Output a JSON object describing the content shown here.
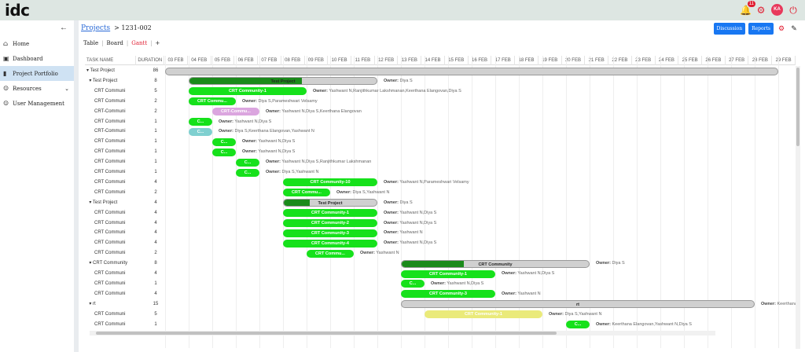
{
  "app": {
    "logo": "idc",
    "bell_count": "11",
    "avatar": "KA"
  },
  "sidebar": {
    "items": [
      {
        "label": "Home",
        "icon": "home-icon"
      },
      {
        "label": "Dashboard",
        "icon": "dashboard-icon"
      },
      {
        "label": "Project Portfolio",
        "icon": "portfolio-icon"
      },
      {
        "label": "Resources",
        "icon": "people-icon"
      },
      {
        "label": "User Management",
        "icon": "users-icon"
      }
    ]
  },
  "breadcrumb": {
    "link": "Projects",
    "current": "> 1231-002"
  },
  "views": {
    "table": "Table",
    "board": "Board",
    "gantt": "Gantt",
    "add": "+"
  },
  "actions": {
    "discussion": "Discussion",
    "reports": "Reports"
  },
  "columns": {
    "task": "TASK NAME",
    "duration": "DURATION"
  },
  "dates": [
    "03 FEB",
    "04 FEB",
    "05 FEB",
    "06 FEB",
    "07 FEB",
    "08 FEB",
    "09 FEB",
    "10 FEB",
    "11 FEB",
    "12 FEB",
    "13 FEB",
    "14 FEB",
    "15 FEB",
    "16 FEB",
    "17 FEB",
    "18 FEB",
    "19 FEB",
    "20 FEB",
    "21 FEB",
    "22 FEB",
    "23 FEB",
    "24 FEB",
    "25 FEB",
    "26 FEB",
    "27 FEB",
    "28 FEB",
    "29 FEB"
  ],
  "owner_label": "Owner:",
  "colors": {
    "green": "#16e11b",
    "dark_green": "#1a8a1a",
    "pink": "#dba5df",
    "teal": "#7fd0d0",
    "yellow": "#eaea7a",
    "grey": "#d0d0d0"
  },
  "tasks": [
    {
      "name": "▾ Test Project",
      "dur": "86",
      "start": 0,
      "len": 26,
      "type": "proj",
      "label": "",
      "owner": "",
      "progress": 0
    },
    {
      "name": "  ▾ Test Project",
      "dur": "8",
      "start": 1,
      "len": 8,
      "type": "proj",
      "label": "Test Project",
      "owner": "Diya S",
      "progress": 0.6
    },
    {
      "name": "      CRT Communi",
      "dur": "5",
      "start": 1,
      "len": 5,
      "type": "green",
      "label": "CRT Community-1",
      "owner": "Yashwant N,Ranjithkumar Lakshmanan,Keerthana Elangovan,Diya S",
      "progress": 0
    },
    {
      "name": "      CRT Communi",
      "dur": "2",
      "start": 1,
      "len": 2,
      "type": "green",
      "label": "CRT Commu...",
      "owner": "Diya S,Parameshwari Velsamy",
      "progress": 0
    },
    {
      "name": "      CRT-Communi",
      "dur": "2",
      "start": 2,
      "len": 2,
      "type": "pink",
      "label": "CRT-Commu...",
      "owner": "Yashwant N,Diya S,Keerthana Elangovan",
      "progress": 0
    },
    {
      "name": "      CRT Communi",
      "dur": "1",
      "start": 1,
      "len": 1,
      "type": "green",
      "label": "C...",
      "owner": "Yashwant N,Diya S",
      "progress": 0
    },
    {
      "name": "      CRT-Communi",
      "dur": "1",
      "start": 1,
      "len": 1,
      "type": "teal",
      "label": "C...",
      "owner": "Diya S,Keerthana Elangovan,Yashwant N",
      "progress": 0
    },
    {
      "name": "      CRT Communi",
      "dur": "1",
      "start": 2,
      "len": 1,
      "type": "green",
      "label": "C...",
      "owner": "Yashwant N,Diya S",
      "progress": 0
    },
    {
      "name": "      CRT Communi",
      "dur": "1",
      "start": 2,
      "len": 1,
      "type": "green",
      "label": "C...",
      "owner": "Yashwant N,Diya S",
      "progress": 0
    },
    {
      "name": "      CRT Communi",
      "dur": "1",
      "start": 3,
      "len": 1,
      "type": "green",
      "label": "C...",
      "owner": "Yashwant N,Diya S,Ranjithkumar Lakshmanan",
      "progress": 0
    },
    {
      "name": "      CRT Communi",
      "dur": "1",
      "start": 3,
      "len": 1,
      "type": "green",
      "label": "C...",
      "owner": "Diya S,Yashwant N",
      "progress": 0
    },
    {
      "name": "      CRT Communi",
      "dur": "4",
      "start": 5,
      "len": 4,
      "type": "green",
      "label": "CRT Community-10",
      "owner": "Yashwant N,Parameshwari Velsamy",
      "progress": 0
    },
    {
      "name": "      CRT Communi",
      "dur": "2",
      "start": 5,
      "len": 2,
      "type": "green",
      "label": "CRT Commu...",
      "owner": "Diya S,Yashwant N",
      "progress": 0
    },
    {
      "name": "  ▾ Test Project",
      "dur": "4",
      "start": 5,
      "len": 4,
      "type": "proj",
      "label": "Test Project",
      "owner": "Diya S",
      "progress": 0.28
    },
    {
      "name": "      CRT Communi",
      "dur": "4",
      "start": 5,
      "len": 4,
      "type": "green",
      "label": "CRT Community-1",
      "owner": "Yashwant N,Diya S",
      "progress": 0
    },
    {
      "name": "      CRT Communi",
      "dur": "4",
      "start": 5,
      "len": 4,
      "type": "green",
      "label": "CRT Community-2",
      "owner": "Yashwant N,Diya S",
      "progress": 0
    },
    {
      "name": "      CRT Communi",
      "dur": "4",
      "start": 5,
      "len": 4,
      "type": "green",
      "label": "CRT Community-3",
      "owner": "Yashwant N",
      "progress": 0
    },
    {
      "name": "      CRT Communi",
      "dur": "4",
      "start": 5,
      "len": 4,
      "type": "green",
      "label": "CRT Community-4",
      "owner": "Yashwant N,Diya S",
      "progress": 0
    },
    {
      "name": "      CRT Communi",
      "dur": "2",
      "start": 6,
      "len": 2,
      "type": "green",
      "label": "CRT Commu...",
      "owner": "Yashwant N",
      "progress": 0
    },
    {
      "name": "  ▾ CRT Community",
      "dur": "8",
      "start": 10,
      "len": 8,
      "type": "proj",
      "label": "CRT Community",
      "owner": "Diya S",
      "progress": 0.33
    },
    {
      "name": "      CRT Communi",
      "dur": "4",
      "start": 10,
      "len": 4,
      "type": "green",
      "label": "CRT Community-1",
      "owner": "Yashwant N,Diya S",
      "progress": 0
    },
    {
      "name": "      CRT Communi",
      "dur": "1",
      "start": 10,
      "len": 1,
      "type": "green",
      "label": "C...",
      "owner": "Yashwant N,Diya S",
      "progress": 0
    },
    {
      "name": "      CRT Communi",
      "dur": "4",
      "start": 10,
      "len": 4,
      "type": "green",
      "label": "CRT Community-3",
      "owner": "Yashwant N",
      "progress": 0
    },
    {
      "name": "  ▾ rt",
      "dur": "15",
      "start": 10,
      "len": 15,
      "type": "proj",
      "label": "rt",
      "owner": "Keerthana",
      "progress": 0
    },
    {
      "name": "      CRT Communi",
      "dur": "5",
      "start": 11,
      "len": 5,
      "type": "yellow",
      "label": "CRT Community-1",
      "owner": "Diya S,Yashwant N",
      "progress": 0
    },
    {
      "name": "      CRT Communi",
      "dur": "1",
      "start": 17,
      "len": 1,
      "type": "green",
      "label": "C...",
      "owner": "Keerthana Elangovan,Yashwant N,Diya S",
      "progress": 0
    }
  ]
}
